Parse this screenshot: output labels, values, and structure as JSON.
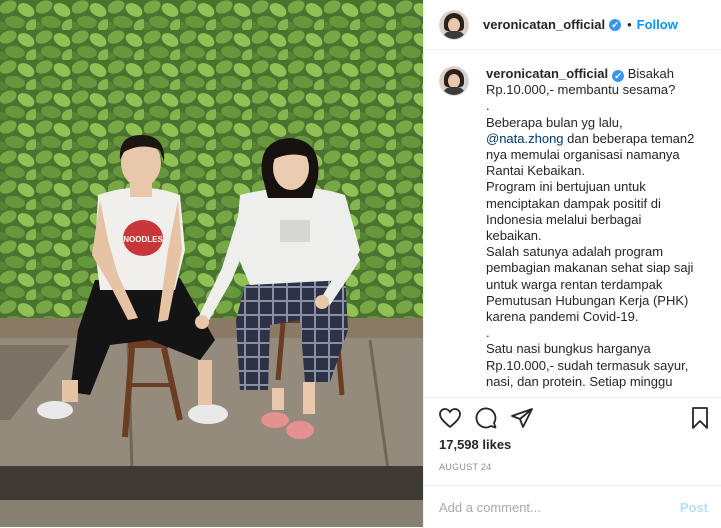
{
  "post": {
    "username": "veronicatan_official",
    "follow_label": "Follow",
    "dot": "•",
    "verified_icon": "✔",
    "caption_lines": [
      "Bisakah",
      "Rp.10.000,- membantu sesama?",
      ".",
      "Beberapa bulan yg lalu,",
      "@nata.zhong dan beberapa teman2",
      "nya memulai organisasi namanya",
      "Rantai Kebaikan.",
      "Program ini bertujuan untuk",
      "menciptakan dampak positif di",
      "Indonesia melalui berbagai",
      "kebaikan.",
      "Salah satunya adalah program",
      "pembagian makanan sehat siap saji",
      "untuk warga rentan terdampak",
      "Pemutusan Hubungan Kerja (PHK)",
      "karena pandemi Covid-19.",
      ".",
      "Satu nasi bungkus harganya",
      "Rp.10.000,- sudah termasuk sayur,",
      "nasi, dan protein. Setiap minggu"
    ],
    "mention": "@nata.zhong",
    "likes": "17,598 likes",
    "date": "AUGUST 24",
    "comment_placeholder": "Add a comment...",
    "post_label": "Post",
    "shirt_text": "NOODLES"
  },
  "colors": {
    "link": "#0095f6",
    "verified": "#3897f0",
    "mention": "#00376b"
  },
  "icons": [
    "heart-icon",
    "comment-icon",
    "share-icon",
    "bookmark-icon",
    "verified-icon"
  ]
}
